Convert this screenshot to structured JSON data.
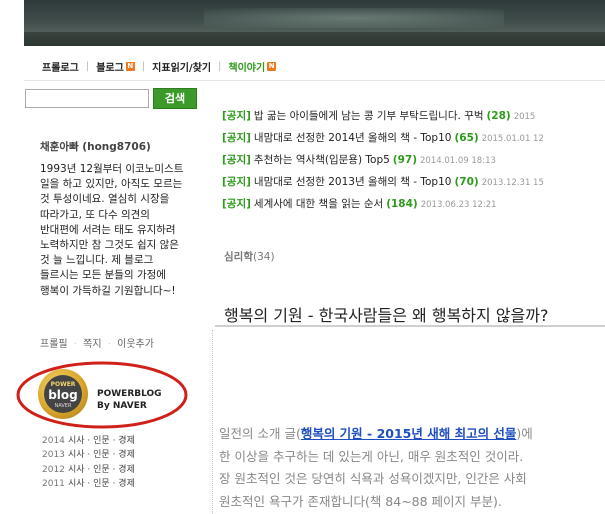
{
  "nav": {
    "items": [
      {
        "label": "프롤로그"
      },
      {
        "label": "블로그",
        "badge": "N"
      },
      {
        "label": "지표읽기/찾기"
      },
      {
        "label": "책이야기",
        "badge": "N"
      }
    ]
  },
  "search": {
    "value": "",
    "button_label": "검색"
  },
  "profile": {
    "name": "채훈아빠 (hong8706)",
    "bio": "1993년 12월부터 이코노미스트 일을 하고 있지만, 아직도 모르는 것 투성이네요. 열심히 시장을 따라가고, 또 다수 의견의 반대편에 서려는 태도 유지하려 노력하지만 참 그것도 쉽지 않은 것 늘 느낍니다. 제 블로그 들르시는 모든 분들의 가정에 행복이 가득하길 기원합니다~!",
    "links": [
      "프롤필",
      "쪽지",
      "이웃추가"
    ]
  },
  "powerblog": {
    "badge_top": "POWER",
    "badge_main": "blog",
    "badge_bottom": "NAVER",
    "line1": "POWERBLOG",
    "line2": "By NAVER",
    "years": [
      {
        "year": "2014",
        "category": "시사 · 인문 · 경제"
      },
      {
        "year": "2013",
        "category": "시사 · 인문 · 경제"
      },
      {
        "year": "2012",
        "category": "시사 · 인문 · 경제"
      },
      {
        "year": "2011",
        "category": "시사 · 인문 · 경제"
      }
    ]
  },
  "notices": [
    {
      "tag": "[공지]",
      "title": "밥 굶는 아이들에게 남는 콩 기부 부탁드립니다. 꾸벅",
      "count": "(28)",
      "date": "2015"
    },
    {
      "tag": "[공지]",
      "title": "내맘대로 선정한 2014년 올해의 책 - Top10",
      "count": "(65)",
      "date": "2015.01.01 12"
    },
    {
      "tag": "[공지]",
      "title": "추천하는 역사책(입문용) Top5",
      "count": "(97)",
      "date": "2014.01.09 18:13"
    },
    {
      "tag": "[공지]",
      "title": "내맘대로 선정한 2013년 올해의 책 - Top10",
      "count": "(70)",
      "date": "2013.12.31 15"
    },
    {
      "tag": "[공지]",
      "title": "세계사에 대한 책을 읽는 순서",
      "count": "(184)",
      "date": "2013.06.23 12:21"
    }
  ],
  "category": {
    "name": "심리학",
    "count": "(34)"
  },
  "post": {
    "title": "행복의 기원 - 한국사람들은 왜 행복하지 않을까?",
    "body_line1_pre": "일전의 소개 글(",
    "body_line1_link": "행복의 기원 - 2015년 새해 최고의 선물",
    "body_line1_post": ")에",
    "body_line2": "한 이상을 추구하는 데 있는게 아닌, 매우 원초적인 것이라.",
    "body_line3": "장 원초적인 것은 당연히 식욕과 성욕이겠지만, 인간은 사회",
    "body_line4": "원초적인 욕구가 존재합니다(책 84~88 페이지 부분)."
  },
  "colors": {
    "accent_green": "#2f9b1c",
    "badge_orange": "#f0781e",
    "link_blue": "#1e4ebf",
    "highlight_red": "#d0201a"
  }
}
